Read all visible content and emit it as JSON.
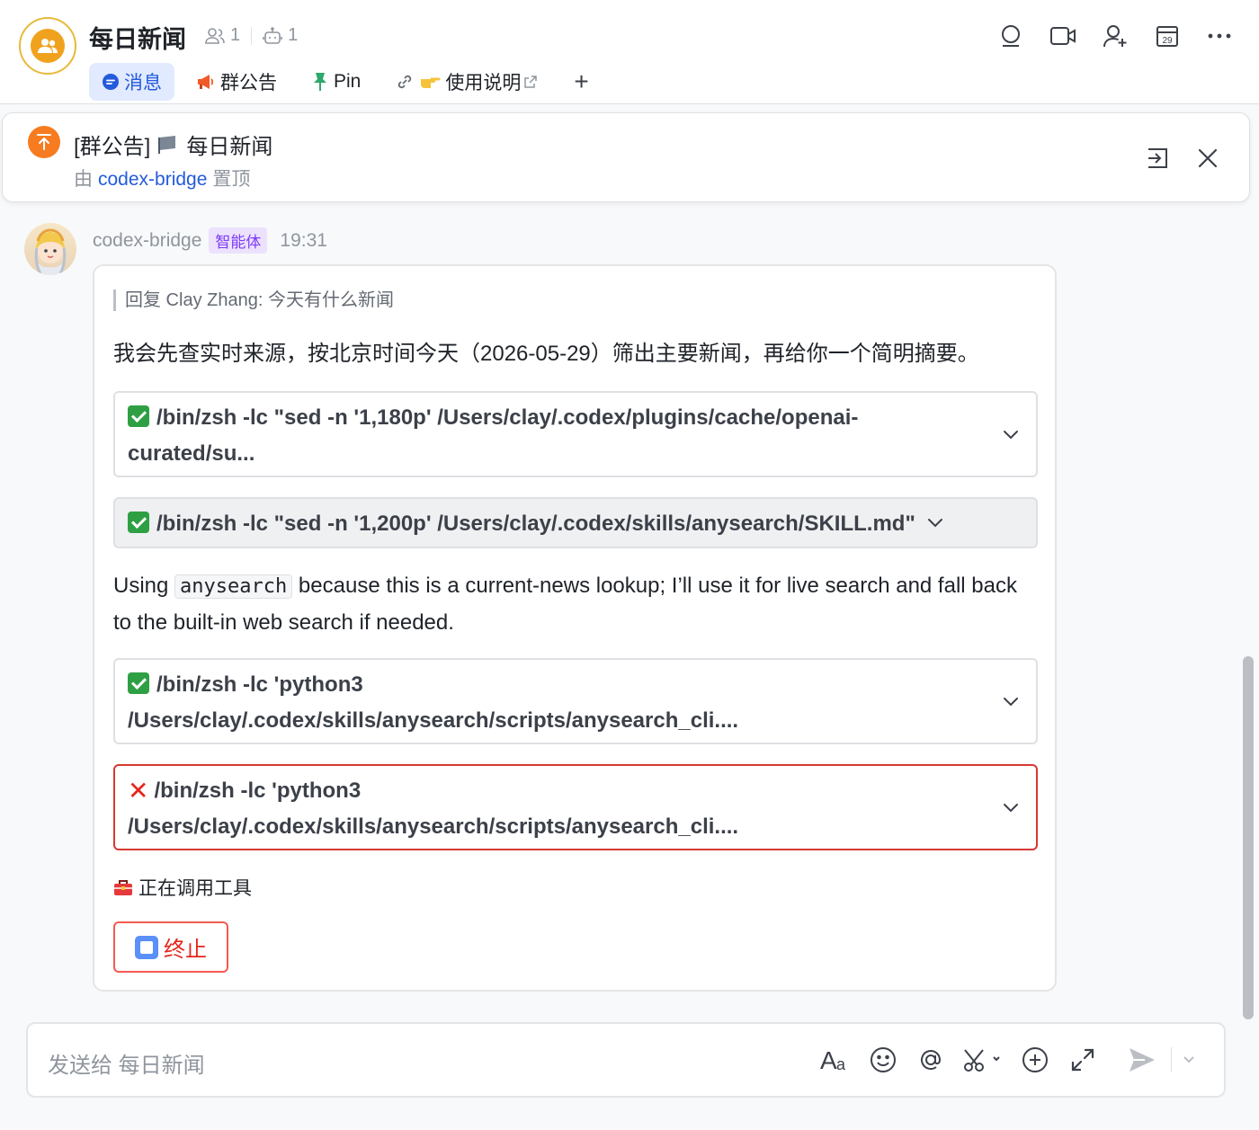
{
  "header": {
    "title": "每日新闻",
    "member_count": "1",
    "bot_count": "1",
    "tabs": [
      {
        "label": "消息",
        "icon": "chat-bubble-icon"
      },
      {
        "label": "群公告",
        "icon": "megaphone-icon"
      },
      {
        "label": "Pin",
        "icon": "pin-icon"
      },
      {
        "label": "使用说明",
        "icon": "link-icon"
      }
    ],
    "add_tab": "+",
    "actions": [
      "search-icon",
      "video-call-icon",
      "add-member-icon",
      "calendar-icon",
      "more-icon"
    ],
    "calendar_day": "29"
  },
  "announcement": {
    "title": "[群公告]",
    "name": "每日新闻",
    "pinned_by_prefix": "由",
    "pinned_by": "codex-bridge",
    "pinned_suffix": "置顶"
  },
  "message": {
    "sender": "codex-bridge",
    "badge": "智能体",
    "time": "19:31",
    "reply_to": "回复 Clay Zhang:  今天有什么新闻",
    "intro": "我会先查实时来源，按北京时间今天（2026-05-29）筛出主要新闻，再给你一个简明摘要。",
    "tools": [
      {
        "status": "success",
        "text": "/bin/zsh -lc \"sed -n '1,180p' /Users/clay/.codex/plugins/cache/openai-curated/su..."
      },
      {
        "status": "success",
        "text": "/bin/zsh -lc \"sed -n '1,200p' /Users/clay/.codex/skills/anysearch/SKILL.md\""
      },
      {
        "status": "success",
        "text": "/bin/zsh -lc 'python3 /Users/clay/.codex/skills/anysearch/scripts/anysearch_cli...."
      },
      {
        "status": "error",
        "text": "/bin/zsh -lc 'python3 /Users/clay/.codex/skills/anysearch/scripts/anysearch_cli...."
      }
    ],
    "explain_before": "Using",
    "explain_code": "anysearch",
    "explain_after": "because this is a current-news lookup; I’ll use it for live search and fall back to the built-in web search if needed.",
    "status_text": "正在调用工具",
    "stop_label": "终止"
  },
  "composer": {
    "placeholder": "发送给 每日新闻",
    "tools": [
      "font-format-icon",
      "emoji-icon",
      "mention-icon",
      "screenshot-scissors-icon",
      "add-circle-icon",
      "expand-icon",
      "send-icon",
      "send-options-chevron-icon"
    ]
  },
  "colors": {
    "accent": "#245bdb",
    "error": "#d83931",
    "success": "#2ea043",
    "badge": "#7f3bf5"
  }
}
